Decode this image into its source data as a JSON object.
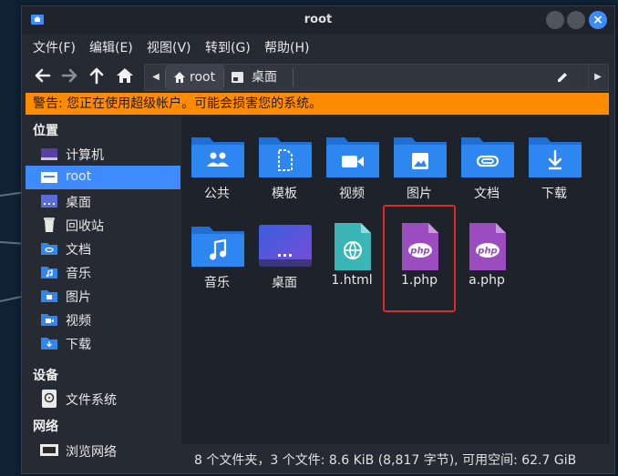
{
  "window": {
    "title": "root"
  },
  "menu": [
    "文件(F)",
    "编辑(E)",
    "视图(V)",
    "转到(G)",
    "帮助(H)"
  ],
  "pathbar": {
    "crumbs": [
      "root",
      "桌面"
    ]
  },
  "warning": "警告: 您正在使用超级帐户。可能会损害您的系统。",
  "sidebar": {
    "places_header": "位置",
    "places": [
      "计算机",
      "root",
      "桌面",
      "回收站",
      "文档",
      "音乐",
      "图片",
      "视频",
      "下载"
    ],
    "devices_header": "设备",
    "devices": [
      "文件系统"
    ],
    "network_header": "网络",
    "network": [
      "浏览网络"
    ]
  },
  "files": [
    "公共",
    "模板",
    "视频",
    "图片",
    "文档",
    "下载",
    "音乐",
    "桌面",
    "1.html",
    "1.php",
    "a.php"
  ],
  "status": "8 个文件夹，3 个文件: 8.6 KiB (8,817 字节), 可用空间: 62.7 GiB",
  "colors": {
    "accent": "#3d8bff",
    "warning": "#ff8c00",
    "folder": "#2e86f0",
    "php": "#9b4dbf",
    "html": "#3bb5b5",
    "highlight": "#e0262a"
  }
}
